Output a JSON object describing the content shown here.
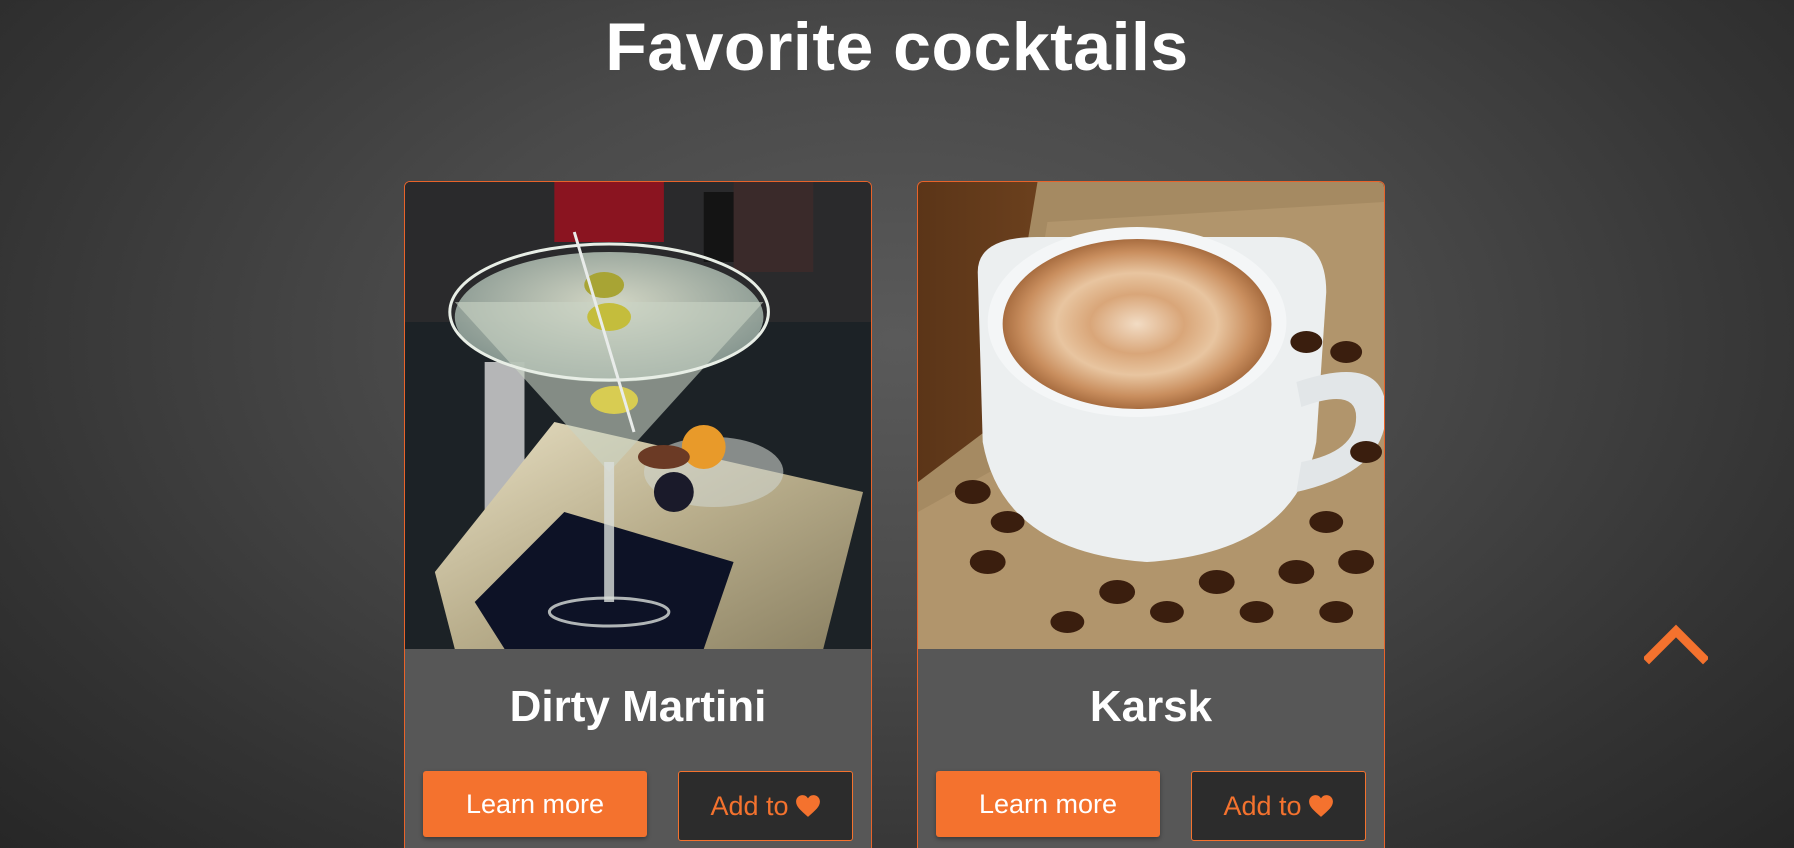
{
  "page": {
    "title": "Favorite cocktails"
  },
  "cards": [
    {
      "name": "Dirty Martini",
      "image": "martini-glass-with-olives",
      "learn_label": "Learn more",
      "add_label": "Add to",
      "add_icon": "heart-icon"
    },
    {
      "name": "Karsk",
      "image": "coffee-cup-with-beans",
      "learn_label": "Learn more",
      "add_label": "Add to",
      "add_icon": "heart-icon"
    }
  ],
  "scroll_top": {
    "icon": "chevron-up-icon"
  },
  "colors": {
    "accent": "#f4722e",
    "card_border": "#e8632a",
    "card_background": "#575757",
    "add_button_background": "#2c2c2c",
    "title_text": "#ffffff"
  }
}
